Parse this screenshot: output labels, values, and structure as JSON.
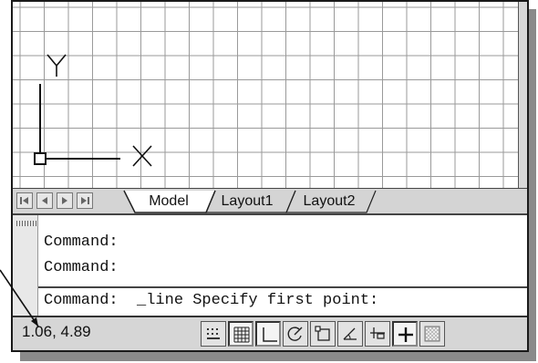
{
  "canvas": {
    "ucs_x_label": "X",
    "ucs_y_label": "Y"
  },
  "tabs": {
    "model": "Model",
    "layout1": "Layout1",
    "layout2": "Layout2"
  },
  "command": {
    "lines": [
      "Command:",
      "Command:",
      "Command:  _line Specify first point:"
    ]
  },
  "status": {
    "coordinates": "1.06, 4.89",
    "buttons": [
      "snap-icon",
      "grid-icon",
      "ortho-icon",
      "polar-icon",
      "osnap-icon",
      "otrack-icon",
      "lineweight-icon",
      "crosshair-icon",
      "model-icon"
    ]
  }
}
